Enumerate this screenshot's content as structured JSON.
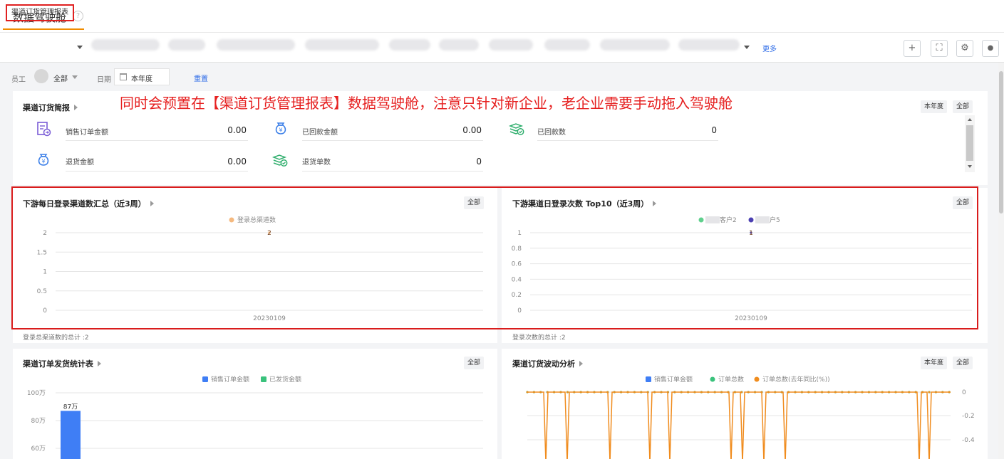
{
  "page": {
    "title": "数据驾驶舱"
  },
  "tabs": {
    "active": "渠道订货管理报表",
    "more": "更多"
  },
  "toolbar": {
    "add": "+",
    "expand": "⛶",
    "settings": "⚙",
    "shield": "🛡"
  },
  "filters": {
    "employee_label": "员工",
    "employee_value": "全部",
    "date_label": "日期",
    "date_value": "本年度",
    "reset": "重置"
  },
  "annotation": "同时会预置在【渠道订货管理报表】数据驾驶舱，注意只针对新企业，老企业需要手动拖入驾驶舱",
  "summary": {
    "title": "渠道订货简报",
    "chip_year": "本年度",
    "chip_all": "全部",
    "kpis": [
      {
        "label": "销售订单金额",
        "value": "0.00",
        "icon": "order-icon"
      },
      {
        "label": "已回款金额",
        "value": "0.00",
        "icon": "money-bag-icon"
      },
      {
        "label": "已回款数",
        "value": "0",
        "icon": "cash-stack-icon"
      },
      {
        "label": "退货金额",
        "value": "0.00",
        "icon": "money-bag-icon"
      },
      {
        "label": "退货单数",
        "value": "0",
        "icon": "cash-stack-icon"
      }
    ]
  },
  "login_chart": {
    "title": "下游每日登录渠道数汇总（近3周）",
    "chip": "全部",
    "footnote": "登录总渠道数的总计 :2"
  },
  "top10_chart": {
    "title": "下游渠道日登录次数 Top10（近3周）",
    "chip": "全部",
    "legend_fragments": [
      "客户2",
      "户5"
    ],
    "footnote": "登录次数的总计 :2"
  },
  "ship_chart": {
    "title": "渠道订单发货统计表",
    "chip": "全部"
  },
  "fluct_chart": {
    "title": "渠道订货波动分析",
    "chip_year": "本年度",
    "chip_all": "全部"
  },
  "chart_data": [
    {
      "type": "line",
      "title": "下游每日登录渠道数汇总（近3周）",
      "x": [
        "20230109"
      ],
      "series": [
        {
          "name": "登录总渠道数",
          "values": [
            2
          ],
          "color": "#f5b97f"
        }
      ],
      "ylim": [
        0,
        2
      ],
      "yticks": [
        "0",
        "0.5",
        "1",
        "1.5",
        "2"
      ],
      "data_labels": [
        "2"
      ],
      "legend": "top-center",
      "grid": true
    },
    {
      "type": "line",
      "title": "下游渠道日登录次数 Top10（近3周）",
      "x": [
        "20230109"
      ],
      "series": [
        {
          "name": "客户2",
          "values": [
            1
          ],
          "color": "#5fd08d"
        },
        {
          "name": "户5",
          "values": [
            1
          ],
          "color": "#4b3fb2"
        }
      ],
      "ylim": [
        0,
        1
      ],
      "yticks": [
        "0",
        "0.2",
        "0.4",
        "0.6",
        "0.8",
        "1"
      ],
      "data_labels": [
        "1"
      ],
      "legend": "top-center",
      "grid": true
    },
    {
      "type": "bar",
      "title": "渠道订单发货统计表",
      "series": [
        {
          "name": "销售订单金额",
          "color": "#3f7ef5",
          "values": [
            87
          ]
        },
        {
          "name": "已发货金额",
          "color": "#3ac27c",
          "values": []
        }
      ],
      "yticks": [
        "60万",
        "80万",
        "100万"
      ],
      "data_labels": [
        "87万"
      ],
      "unit": "万",
      "legend": "top-center",
      "grid": true
    },
    {
      "type": "line",
      "title": "渠道订货波动分析",
      "series": [
        {
          "name": "销售订单金额",
          "color": "#3f7ef5",
          "values": []
        },
        {
          "name": "订单总数",
          "color": "#3ac27c",
          "values": []
        },
        {
          "name": "订单总数(去年同比(%))",
          "color": "#f08c1e",
          "values": []
        }
      ],
      "yticks": [
        "0",
        "-0.2",
        "-0.4"
      ],
      "legend": "top-center",
      "grid": true
    }
  ]
}
